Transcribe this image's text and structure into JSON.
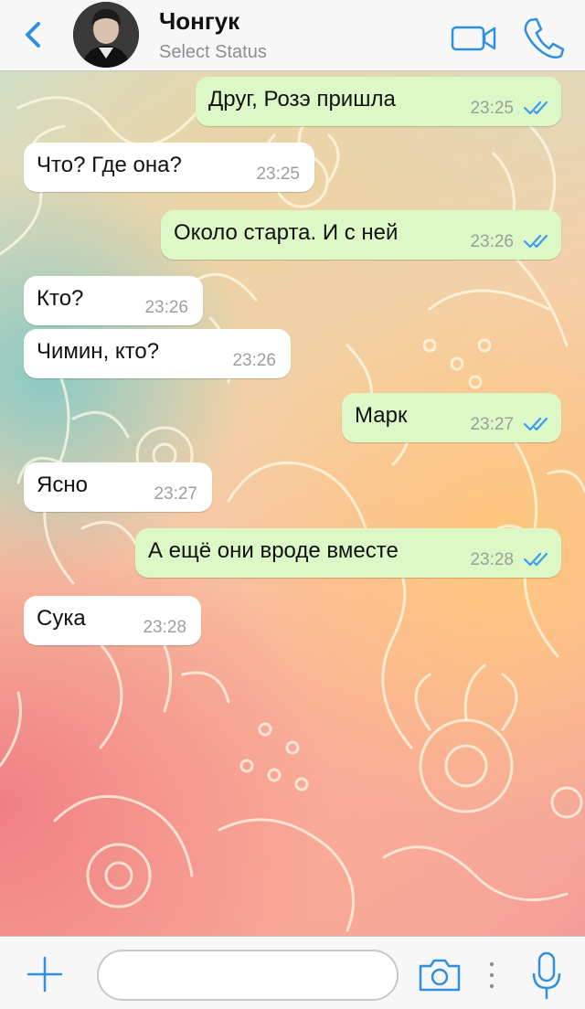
{
  "header": {
    "contact_name": "Чонгук",
    "status": "Select Status"
  },
  "icons": {
    "back": "chevron-left-icon",
    "video": "video-camera-icon",
    "call": "phone-icon",
    "add": "plus-icon",
    "camera": "camera-icon",
    "more": "vertical-dots-icon",
    "mic": "microphone-icon",
    "read_receipt": "double-check-icon"
  },
  "colors": {
    "accent": "#2f8fe0",
    "outgoing_bubble": "#dcf8c6",
    "incoming_bubble": "#ffffff",
    "ticks": "#3b9df0"
  },
  "messages": [
    {
      "direction": "out",
      "text": "Друг, Розэ пришла",
      "time": "23:25"
    },
    {
      "direction": "in",
      "text": "Что? Где она?",
      "time": "23:25"
    },
    {
      "direction": "out",
      "text": "Около старта. И с ней",
      "time": "23:26"
    },
    {
      "direction": "in",
      "text": "Кто?",
      "time": "23:26"
    },
    {
      "direction": "in",
      "text": "Чимин, кто?",
      "time": "23:26"
    },
    {
      "direction": "out",
      "text": "Марк",
      "time": "23:27"
    },
    {
      "direction": "in",
      "text": "Ясно",
      "time": "23:27"
    },
    {
      "direction": "out",
      "text": "А ещё они вроде вместе",
      "time": "23:28"
    },
    {
      "direction": "in",
      "text": "Сука",
      "time": "23:28"
    }
  ],
  "input": {
    "value": "",
    "placeholder": ""
  }
}
